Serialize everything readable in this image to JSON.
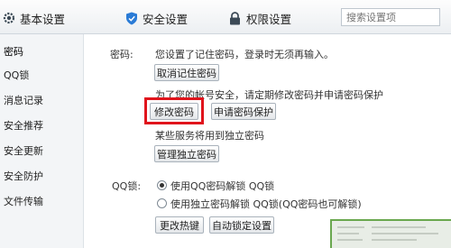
{
  "tabs": [
    {
      "label": "基本设置",
      "icon": "gear-icon",
      "active": false
    },
    {
      "label": "安全设置",
      "icon": "shield-icon",
      "active": true
    },
    {
      "label": "权限设置",
      "icon": "lock-icon",
      "active": false
    }
  ],
  "search": {
    "placeholder": "搜索设置项"
  },
  "sidebar": {
    "items": [
      {
        "label": "密码",
        "active": true
      },
      {
        "label": "QQ锁"
      },
      {
        "label": "消息记录"
      },
      {
        "label": "安全推荐"
      },
      {
        "label": "安全更新"
      },
      {
        "label": "安全防护"
      },
      {
        "label": "文件传输"
      }
    ]
  },
  "password": {
    "section_label": "密码:",
    "status_text": "您设置了记住密码，登录时无须再输入。",
    "cancel_remember_button": "取消记住密码",
    "tip_text": "为了您的帐号安全，请定期修改密码并申请密码保护",
    "change_password_button": "修改密码",
    "apply_protection_button": "申请密码保护",
    "independent_tip": "某些服务将用到独立密码",
    "manage_independent_button": "管理独立密码"
  },
  "qqlock": {
    "section_label": "QQ锁:",
    "options": [
      {
        "label": "使用QQ密码解锁 QQ锁",
        "selected": true
      },
      {
        "label": "使用独立密码解锁 QQ锁(QQ密码也可解锁)",
        "selected": false
      }
    ],
    "change_hotkey_button": "更改热键",
    "auto_lock_button": "自动锁定设置"
  },
  "colors": {
    "highlight": "#e0141c",
    "shield": "#2a7bd6",
    "thumb_border": "#6aa84f"
  }
}
